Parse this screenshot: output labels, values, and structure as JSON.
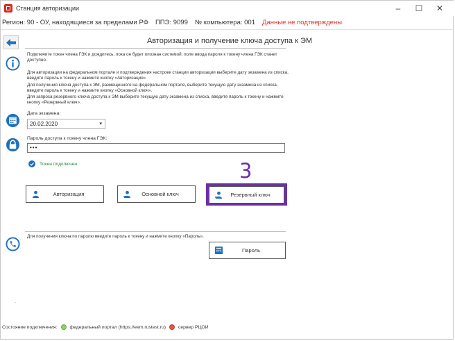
{
  "window": {
    "title": "Станция авторизации",
    "controls": [
      "–",
      "☐",
      "✕"
    ]
  },
  "info": {
    "region": "Регион: 90 - ОУ, находящиеся за пределами РФ",
    "ppe": "ППЭ: 9099",
    "computer": "№ компьютера: 001",
    "warning": "Данные не подтверждены"
  },
  "page": {
    "title": "Авторизация и получение ключа доступа к ЭМ",
    "para1": "Подключите токен члена ГЭК и дождитесь, пока он будет опознан системой: поле ввода пароля к токену члена ГЭК станет доступно.",
    "para2": "Для авторизации на федеральном портале и подтверждения настроек станции авторизации выберите дату экзамена из списка, введите пароль к токену и нажмите кнопку «Авторизация»",
    "para3": "Для получения ключа доступа к ЭМ, размещенного на федеральном портале, выберите текущую дату экзамена из списка, введите пароль к токену и нажмите кнопку «Основной ключ».",
    "para4": "Для запроса резервного ключа доступа к ЭМ выберите текущую дату экзамена из списка, введите пароль к токену и нажмите кнопку «Резервный ключ».",
    "date_label": "Дата экзамена:",
    "date_value": "20.02.2020",
    "pwd_label": "Пароль доступа к токену члена ГЭК:",
    "pwd_value": "•••",
    "token_status": "Токен подключен",
    "buttons": {
      "auth": "Авторизация",
      "main_key": "Основной ключ",
      "reserve_key": "Резервный ключ",
      "password": "Пароль"
    },
    "step_number": "3",
    "password_hint": "Для получения ключа по паролю введите пароль к токену и нажмите кнопку «Пароль».",
    "bottom_mark": "."
  },
  "status": {
    "label": "Состояние подключения:",
    "portal": "федеральный портал (https://eem.rustest.ru)",
    "rcoi": "сервер РЦОИ"
  },
  "colors": {
    "accent_blue": "#1f6fbf",
    "warning_red": "#e0322a",
    "highlight_purple": "#6b2fa8",
    "ok_green": "#6aa84f"
  }
}
